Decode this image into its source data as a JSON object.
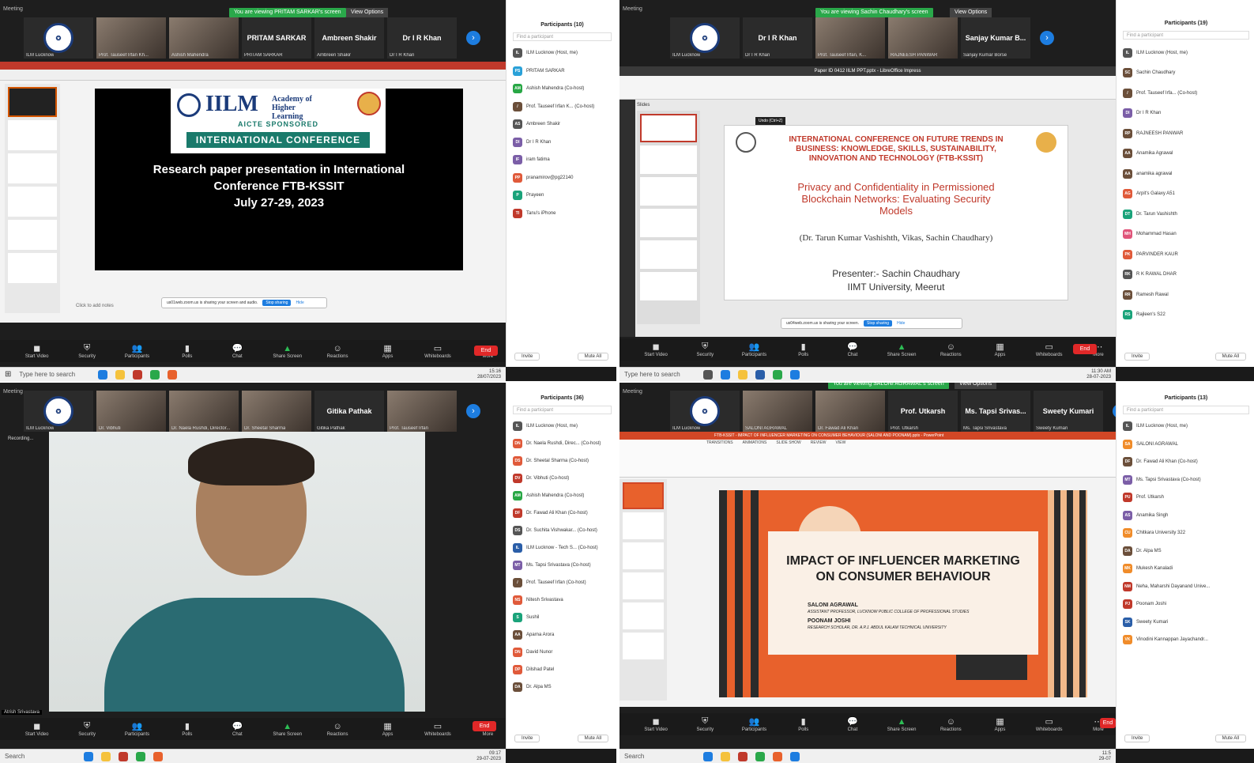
{
  "q1": {
    "window_title": "Meeting",
    "share_banner": "You are viewing PRITAM SARKAR's screen",
    "view_options": "View Options",
    "tiles": [
      {
        "name": "ILM Lucknow",
        "label": ""
      },
      {
        "name": "Prof. Tauseef Irfan Kh...",
        "label": ""
      },
      {
        "name": "Ashish Mahendra",
        "label": ""
      },
      {
        "name": "PRITAM SARKAR",
        "label": "PRITAM SARKAR"
      },
      {
        "name": "Ambreen Shakir",
        "label": "Ambreen Shakir"
      },
      {
        "name": "Dr I R Khan",
        "label": "Dr I R Khan"
      }
    ],
    "slide": {
      "org_name": "IILM",
      "org_sub": "Academy of Higher Learning",
      "sponsor": "AICTE SPONSORED",
      "banner": "INTERNATIONAL CONFERENCE",
      "line1": "Research paper presentation in International",
      "line2": "Conference FTB-KSSIT",
      "line3": "July 27-29, 2023",
      "notes": "Click to add notes",
      "sharing_msg": "us01web.zoom.us is sharing your screen and audio.",
      "stop_sharing": "Stop sharing",
      "hide": "Hide"
    },
    "toolbar": [
      "Start Video",
      "Security",
      "Participants",
      "Polls",
      "Chat",
      "Share Screen",
      "Reactions",
      "Apps",
      "Whiteboards",
      "More"
    ],
    "end": "End",
    "taskbar_search": "Type here to search",
    "clock": [
      "15:16",
      "28/07/2023"
    ],
    "participants_title": "Participants (10)",
    "find": "Find a participant",
    "participants": [
      {
        "initials": "IL",
        "name": "ILM Lucknow (Host, me)",
        "color": "#555555"
      },
      {
        "initials": "PS",
        "name": "PRITAM SARKAR",
        "color": "#2aa1d8"
      },
      {
        "initials": "AM",
        "name": "Ashish Mahendra (Co-host)",
        "color": "#28a745"
      },
      {
        "initials": "/",
        "name": "Prof. Tauseef Irfan K... (Co-host)",
        "color": "#6b4f3a"
      },
      {
        "initials": "AS",
        "name": "Ambreen Shakir",
        "color": "#555555"
      },
      {
        "initials": "DI",
        "name": "Dr I R Khan",
        "color": "#7b5ea7"
      },
      {
        "initials": "IF",
        "name": "iram fatima",
        "color": "#7b5ea7"
      },
      {
        "initials": "PP",
        "name": "pranamirov@pg22140",
        "color": "#e05a3a"
      },
      {
        "initials": "P",
        "name": "Prayeen",
        "color": "#1aa37a"
      },
      {
        "initials": "TI",
        "name": "Tanu's iPhone",
        "color": "#c0392b"
      }
    ],
    "invite": "Invite",
    "mute_all": "Mute All"
  },
  "q2": {
    "window_title": "Meeting",
    "share_banner": "You are viewing Sachin Chaudhary's screen",
    "view_options": "View Options",
    "tiles": [
      {
        "name": "ILM Lucknow",
        "label": ""
      },
      {
        "name": "Dr I R Khan",
        "label": "Dr I R Khan"
      },
      {
        "name": "Prof. Tauseef Irfan, K...",
        "label": ""
      },
      {
        "name": "RAJNEESH PANWAR",
        "label": ""
      },
      {
        "name": "Sanjay Kumar Borse",
        "label": "Sanjay Kumar B..."
      }
    ],
    "app_title": "Paper ID 0412 IILM PPT.pptx - LibreOffice Impress",
    "slides_label": "Slides",
    "tooltip": "Undo (Ctrl+Z)",
    "slide": {
      "conf_line1": "INTERNATIONAL CONFERENCE ON FUTURE TRENDS IN",
      "conf_line2": "BUSINESS: KNOWLEDGE, SKILLS, SUSTAINABILITY,",
      "conf_line3": "INNOVATION AND TECHNOLOGY (FTB-KSSIT)",
      "title1": "Privacy and Confidentiality in Permissioned",
      "title2": "Blockchain Networks: Evaluating Security",
      "title3": "Models",
      "authors": "(Dr. Tarun Kumar Vashishth, Vikas, Sachin Chaudhary)",
      "presenter": "Presenter:-  Sachin Chaudhary",
      "university": "IIMT University, Meerut",
      "sharing_msg": "us04web.zoom.us is sharing your screen.",
      "stop_sharing": "Stop sharing",
      "hide": "Hide"
    },
    "toolbar": [
      "Start Video",
      "Security",
      "Participants",
      "Polls",
      "Chat",
      "Share Screen",
      "Reactions",
      "Apps",
      "Whiteboards",
      "More"
    ],
    "end": "End",
    "taskbar_search": "Type here to search",
    "clock": [
      "11:30 AM",
      "28-07-2023"
    ],
    "participants_title": "Participants (19)",
    "find": "Find a participant",
    "participants": [
      {
        "initials": "IL",
        "name": "ILM Lucknow (Host, me)",
        "color": "#555555"
      },
      {
        "initials": "SC",
        "name": "Sachin Chaudhary",
        "color": "#6b4f3a"
      },
      {
        "initials": "/",
        "name": "Prof. Tauseef Irfa... (Co-host)",
        "color": "#6b4f3a"
      },
      {
        "initials": "DI",
        "name": "Dr I R Khan",
        "color": "#7b5ea7"
      },
      {
        "initials": "RP",
        "name": "RAJNEESH PANWAR",
        "color": "#6b4f3a"
      },
      {
        "initials": "AA",
        "name": "Anamika Agrawal",
        "color": "#6b4f3a"
      },
      {
        "initials": "AA",
        "name": "anamika agrawal",
        "color": "#6b4f3a"
      },
      {
        "initials": "AG",
        "name": "Arpit's Galaxy A51",
        "color": "#e05a3a"
      },
      {
        "initials": "DT",
        "name": "Dr. Tarun Vashishth",
        "color": "#1aa37a"
      },
      {
        "initials": "MH",
        "name": "Mohammad Hasan",
        "color": "#e0557a"
      },
      {
        "initials": "PK",
        "name": "PARVINDER KAUR",
        "color": "#e05a3a"
      },
      {
        "initials": "RK",
        "name": "R K RAWAL DHAR",
        "color": "#555555"
      },
      {
        "initials": "RR",
        "name": "Ramesh Rawal",
        "color": "#6b4f3a"
      },
      {
        "initials": "RS",
        "name": "Rajleen's S22",
        "color": "#1aa37a"
      }
    ],
    "invite": "Invite",
    "mute_all": "Mute All"
  },
  "q3": {
    "window_title": "Meeting",
    "recording": "Recording...",
    "tiles": [
      {
        "name": "ILM Lucknow",
        "label": ""
      },
      {
        "name": "Dr. Vibhuti",
        "label": ""
      },
      {
        "name": "Dr. Naela Rushdi, Director...",
        "label": ""
      },
      {
        "name": "Dr. Sheetal Sharma",
        "label": ""
      },
      {
        "name": "Gitika Pathak",
        "label": "Gitika Pathak"
      },
      {
        "name": "Prof. Tauseef Irfan",
        "label": ""
      }
    ],
    "speaker_name": "Atrish Srivastava",
    "toolbar": [
      "Start Video",
      "Security",
      "Participants",
      "Polls",
      "Chat",
      "Share Screen",
      "Reactions",
      "Apps",
      "Whiteboards",
      "More"
    ],
    "end": "End",
    "taskbar_search": "Search",
    "clock": [
      "09:17",
      "29-07-2023"
    ],
    "participants_title": "Participants (36)",
    "find": "Find a participant",
    "participants": [
      {
        "initials": "IL",
        "name": "ILM Lucknow (Host, me)",
        "color": "#555555"
      },
      {
        "initials": "DN",
        "name": "Dr. Naela Rushdi, Direc... (Co-host)",
        "color": "#e05a3a"
      },
      {
        "initials": "DS",
        "name": "Dr. Sheetal Sharma (Co-host)",
        "color": "#e05a3a"
      },
      {
        "initials": "DV",
        "name": "Dr. Vibhuti (Co-host)",
        "color": "#c0392b"
      },
      {
        "initials": "AM",
        "name": "Ashish Mahendra (Co-host)",
        "color": "#28a745"
      },
      {
        "initials": "DF",
        "name": "Dr. Fawad Ali Khan (Co-host)",
        "color": "#c0392b"
      },
      {
        "initials": "DS",
        "name": "Dr. Suchita Vishwakar... (Co-host)",
        "color": "#555555"
      },
      {
        "initials": "IL",
        "name": "ILM Lucknow - Tech S... (Co-host)",
        "color": "#2a5ea8"
      },
      {
        "initials": "MT",
        "name": "Ms. Tapsi Srivastava (Co-host)",
        "color": "#7b5ea7"
      },
      {
        "initials": "/",
        "name": "Prof. Tauseef Irfan (Co-host)",
        "color": "#6b4f3a"
      },
      {
        "initials": "NS",
        "name": "Nitesh Srivastava",
        "color": "#e05a3a"
      },
      {
        "initials": "S",
        "name": "Sushil",
        "color": "#1aa37a"
      },
      {
        "initials": "AA",
        "name": "Aparna Arora",
        "color": "#6b4f3a"
      },
      {
        "initials": "DN",
        "name": "David Nunor",
        "color": "#e05a3a"
      },
      {
        "initials": "DP",
        "name": "Dilshad Patel",
        "color": "#e05a3a"
      },
      {
        "initials": "DA",
        "name": "Dr. Alpa MS",
        "color": "#6b4f3a"
      }
    ],
    "invite": "Invite",
    "mute_all": "Mute All"
  },
  "q4": {
    "window_title": "Meeting",
    "share_banner": "You are viewing SALONI AGRAWAL's screen",
    "view_options": "View Options",
    "tiles": [
      {
        "name": "ILM Lucknow",
        "label": ""
      },
      {
        "name": "SALONI AGRAWAL",
        "label": ""
      },
      {
        "name": "Dr. Fawad Ali Khan",
        "label": ""
      },
      {
        "name": "Prof. Utkarsh",
        "label": "Prof. Utkarsh"
      },
      {
        "name": "Ms. Tapsi Srivastava",
        "label": "Ms. Tapsi Srivas..."
      },
      {
        "name": "Sweety Kumari",
        "label": "Sweety Kumari"
      }
    ],
    "app_title": "FTB-KSSIT - IMPACT OF INFLUENCER MARKETING ON CONSUMER BEHAVIOUR (SALONI AND POONAM).pptx - PowerPoint",
    "ribbon_tabs": [
      "TRANSITIONS",
      "ANIMATIONS",
      "SLIDE SHOW",
      "REVIEW",
      "VIEW"
    ],
    "slide": {
      "title1": "IMPACT OF INFLUENCER MARKETING",
      "title2": "ON CONSUMER BEHAVIOUR",
      "author1": "SALONI AGRAWAL",
      "author1_role": "ASSISTANT PROFESSOR, LUCKNOW PUBLIC COLLEGE OF PROFESSIONAL STUDIES",
      "author2": "POONAM JOSHI",
      "author2_role": "RESEARCH SCHOLAR, DR. A.P.J. ABDUL KALAM TECHNICAL UNIVERSITY"
    },
    "toolbar": [
      "Start Video",
      "Security",
      "Participants",
      "Polls",
      "Chat",
      "Share Screen",
      "Reactions",
      "Apps",
      "Whiteboards",
      "More"
    ],
    "end": "End",
    "taskbar_search": "Search",
    "clock": [
      "11:5",
      "29-07"
    ],
    "participants_title": "Participants (13)",
    "find": "Find a participant",
    "participants": [
      {
        "initials": "IL",
        "name": "ILM Lucknow (Host, me)",
        "color": "#555555"
      },
      {
        "initials": "SA",
        "name": "SALONI AGRAWAL",
        "color": "#f08c2a"
      },
      {
        "initials": "DF",
        "name": "Dr. Fawad Ali Khan (Co-host)",
        "color": "#6b4f3a"
      },
      {
        "initials": "MT",
        "name": "Ms. Tapsi Srivastava (Co-host)",
        "color": "#7b5ea7"
      },
      {
        "initials": "PU",
        "name": "Prof. Utkarsh",
        "color": "#c0392b"
      },
      {
        "initials": "AS",
        "name": "Anamika Singh",
        "color": "#7b5ea7"
      },
      {
        "initials": "CU",
        "name": "Chitkara University 322",
        "color": "#f08c2a"
      },
      {
        "initials": "DA",
        "name": "Dr. Alpa MS",
        "color": "#6b4f3a"
      },
      {
        "initials": "MK",
        "name": "Mukesh Kanaladi",
        "color": "#f08c2a"
      },
      {
        "initials": "NM",
        "name": "Neha, Maharshi Dayanand Unive...",
        "color": "#c0392b"
      },
      {
        "initials": "PJ",
        "name": "Poonam Joshi",
        "color": "#c0392b"
      },
      {
        "initials": "SK",
        "name": "Sweety Kumari",
        "color": "#2a5ea8"
      },
      {
        "initials": "VK",
        "name": "Vinodini Kannappan Jayachandr...",
        "color": "#f08c2a"
      }
    ],
    "invite": "Invite",
    "mute_all": "Mute All"
  },
  "colors": {
    "zoom_blue": "#1d7de0",
    "share_green": "#2aa84a",
    "end_red": "#e02828",
    "iilm_navy": "#1b3b7a",
    "iilm_teal": "#1a7a6b",
    "ftb_red": "#c0392b",
    "ppt_orange": "#e8612c"
  }
}
